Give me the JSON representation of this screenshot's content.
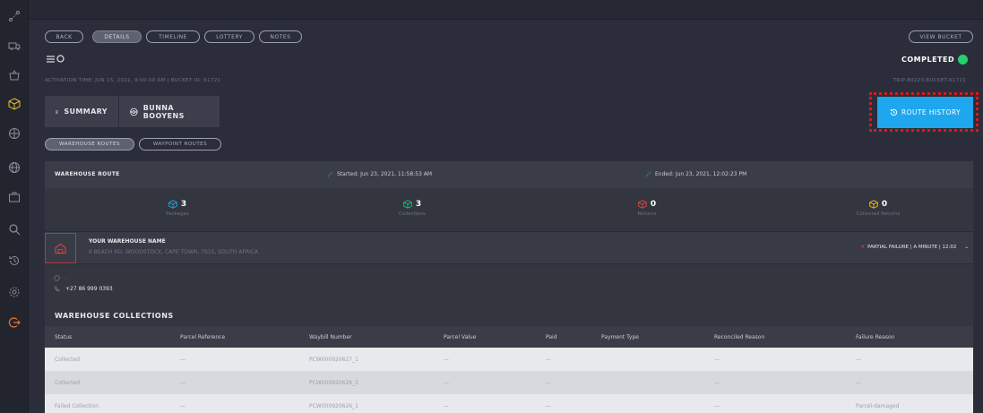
{
  "tabs": [
    {
      "label": "BACK"
    },
    {
      "label": "DETAILS"
    },
    {
      "label": "TIMELINE"
    },
    {
      "label": "LOTTERY"
    },
    {
      "label": "NOTES"
    }
  ],
  "view_bucket": "VIEW BUCKET",
  "status": "COMPLETED",
  "activation": "ACTIVATION TIME: JUN 15, 2021, 9:00:00 AM | BUCKET ID: 61721",
  "trip_id": "TRIP-80223-BUCKET-61721",
  "summary_btn": "SUMMARY",
  "driver_btn": "BUNNA BOOYENS",
  "route_history": "ROUTE HISTORY",
  "route_pills": [
    "WAREHOUSE ROUTES",
    "WAYPOINT ROUTES"
  ],
  "warehouse_route": {
    "title": "WAREHOUSE ROUTE",
    "started": "Started: Jun 23, 2021, 11:58:53 AM",
    "ended": "Ended: Jun 23, 2021, 12:02:23 PM"
  },
  "stats": [
    {
      "value": "3",
      "label": "Packages",
      "color": "#1ea7ee"
    },
    {
      "value": "3",
      "label": "Collections",
      "color": "#22c27a"
    },
    {
      "value": "0",
      "label": "Returns",
      "color": "#e24545"
    },
    {
      "value": "0",
      "label": "Collected Returns",
      "color": "#e6c229"
    }
  ],
  "address": {
    "name": "YOUR WAREHOUSE NAME",
    "line": "6 BEACH RD, WOODSTOCK, CAPE TOWN, 7915, SOUTH AFRICA",
    "status": "PARTIAL FAILURE | A MINUTE | 12:02"
  },
  "contact": {
    "email": "-",
    "phone": "+27 86 999 0393"
  },
  "collections": {
    "title": "WAREHOUSE COLLECTIONS",
    "headers": [
      "Status",
      "Parcel Reference",
      "Waybill Number",
      "Parcel Value",
      "Paid",
      "Payment Type",
      "Reconciled Reason",
      "Failure Reason"
    ],
    "rows": [
      [
        "Collected",
        "—",
        "PCW000920627_1",
        "—",
        "—",
        "",
        "—",
        "—"
      ],
      [
        "Collected",
        "—",
        "PCW000920626_2",
        "—",
        "—",
        "",
        "—",
        "—"
      ],
      [
        "Failed Collection",
        "—",
        "PCW000920626_1",
        "—",
        "—",
        "",
        "—",
        "Parcel-damaged"
      ]
    ]
  }
}
